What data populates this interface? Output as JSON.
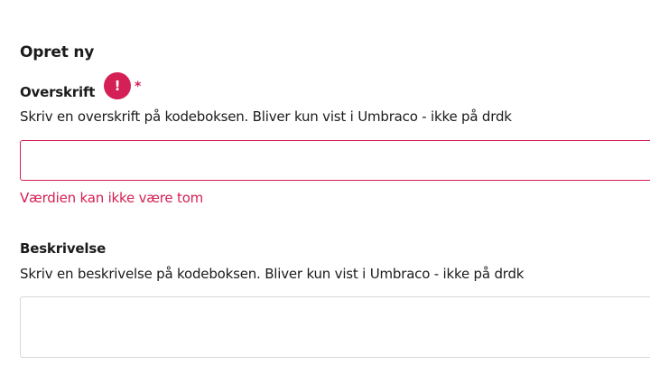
{
  "section": {
    "title": "Opret ny"
  },
  "fields": [
    {
      "label": "Overskrift",
      "alert_glyph": "!",
      "required_marker": "*",
      "description": "Skriv en overskrift på kodeboksen. Bliver kun vist i Umbraco - ikke på drdk",
      "value": "",
      "error": "Værdien kan ikke være tom",
      "state": "invalid"
    },
    {
      "label": "Beskrivelse",
      "description": "Skriv en beskrivelse på kodeboksen. Bliver kun vist i Umbraco - ikke på drdk",
      "value": ""
    }
  ],
  "colors": {
    "error": "#d42054",
    "text": "#1b1b1b",
    "input_border": "#d8d7d9"
  },
  "icons": {
    "validation_alert": "exclamation-circle-icon"
  }
}
